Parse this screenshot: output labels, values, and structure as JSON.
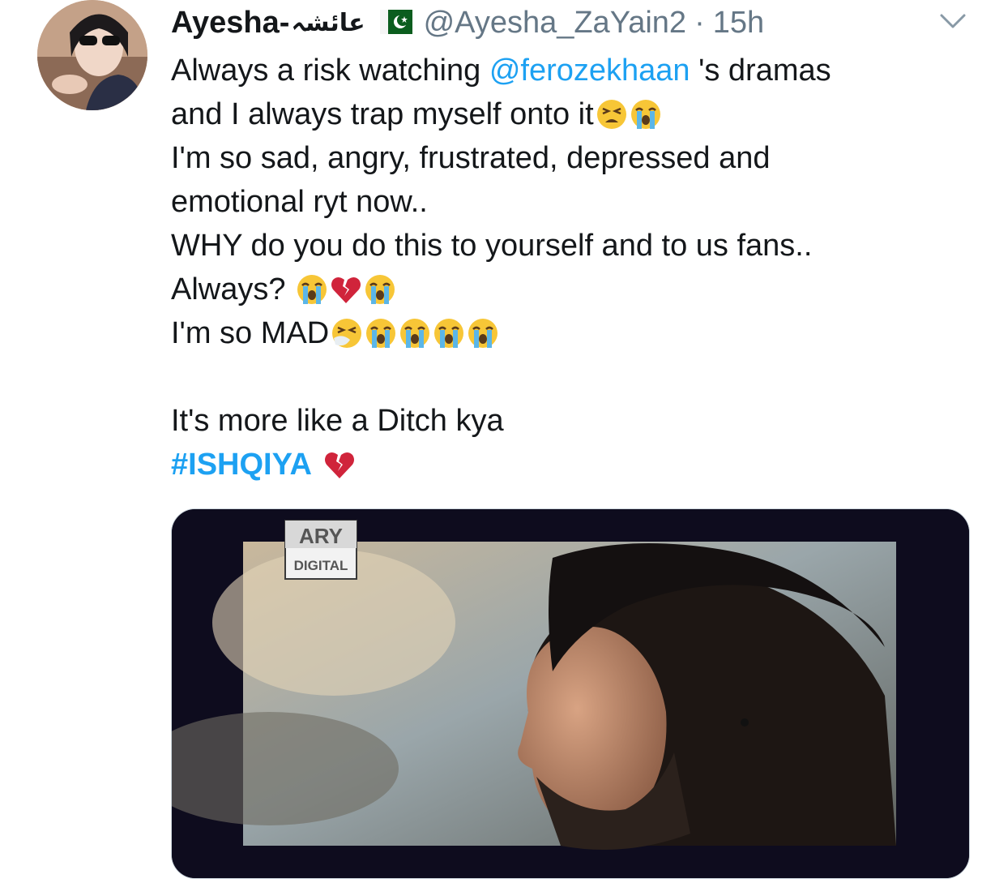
{
  "tweet": {
    "display_name": "Ayesha-",
    "display_name_urdu": "عائشہ",
    "flag_icon": "pakistan-flag-icon",
    "handle": "@Ayesha_ZaYain2",
    "separator": "·",
    "timestamp": "15h",
    "menu_icon": "chevron-down-icon",
    "lines": {
      "l1_a": "Always a risk watching ",
      "l1_mention": "@ferozekhaan",
      "l1_b": " 's dramas",
      "l2": "and I always trap myself onto it",
      "l3": "I'm so sad, angry, frustrated, depressed and",
      "l4": "emotional ryt now..",
      "l5": "WHY do you do this to yourself and to us fans..",
      "l6": "Always? ",
      "l7": "I'm so MAD",
      "l8": "It's more like a Ditch kya",
      "hashtag": "#ISHQIYA"
    },
    "media": {
      "logo_top": "ARY",
      "logo_bottom": "DIGITAL"
    },
    "colors": {
      "accent": "#1da1f2",
      "muted": "#657786",
      "text": "#14171a"
    }
  }
}
